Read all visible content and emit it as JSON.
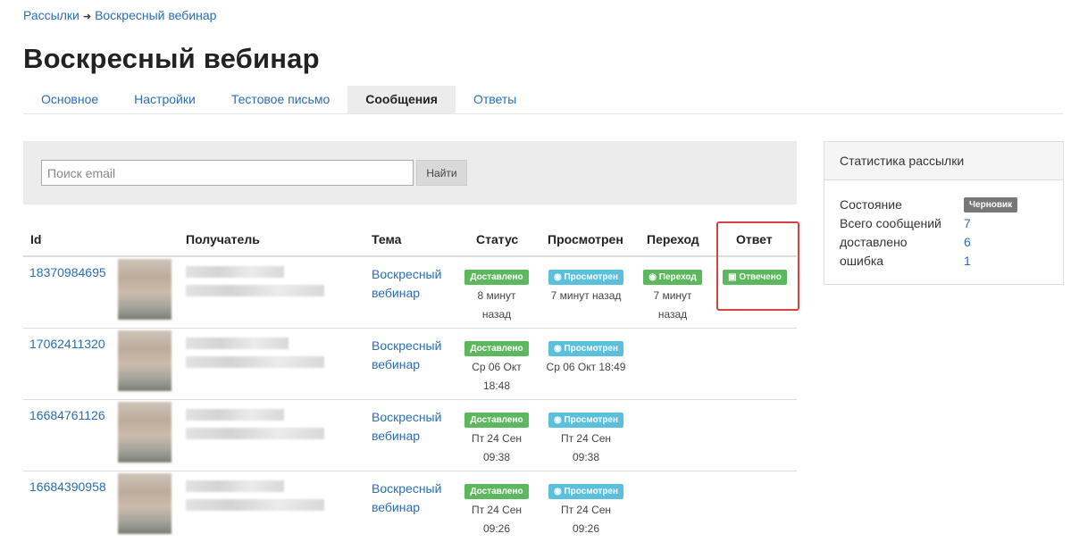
{
  "breadcrumb": {
    "parent": "Рассылки",
    "current": "Воскресный вебинар"
  },
  "page_title": "Воскресный вебинар",
  "tabs": [
    "Основное",
    "Настройки",
    "Тестовое письмо",
    "Сообщения",
    "Ответы"
  ],
  "search": {
    "placeholder": "Поиск email",
    "button": "Найти"
  },
  "table": {
    "headers": {
      "id": "Id",
      "recipient": "Получатель",
      "subject": "Тема",
      "status": "Статус",
      "viewed": "Просмотрен",
      "click": "Переход",
      "reply": "Ответ"
    },
    "rows": [
      {
        "id": "18370984695",
        "subject": "Воскресный вебинар",
        "status": "Доставлено",
        "status_time": "8 минут назад",
        "viewed": "Просмотрен",
        "viewed_time": "7 минут назад",
        "click": "Переход",
        "click_time": "7 минут назад",
        "reply": "Отвечено"
      },
      {
        "id": "17062411320",
        "subject": "Воскресный вебинар",
        "status": "Доставлено",
        "status_time": "Ср 06 Окт 18:48",
        "viewed": "Просмотрен",
        "viewed_time": "Ср 06 Окт 18:49"
      },
      {
        "id": "16684761126",
        "subject": "Воскресный вебинар",
        "status": "Доставлено",
        "status_time": "Пт 24 Сен 09:38",
        "viewed": "Просмотрен",
        "viewed_time": "Пт 24 Сен 09:38"
      },
      {
        "id": "16684390958",
        "subject": "Воскресный вебинар",
        "status": "Доставлено",
        "status_time": "Пт 24 Сен 09:26",
        "viewed": "Просмотрен",
        "viewed_time": "Пт 24 Сен 09:26"
      }
    ]
  },
  "stats": {
    "title": "Статистика рассылки",
    "state_label": "Состояние",
    "state_value": "Черновик",
    "total_label": "Всего сообщений",
    "total_value": "7",
    "delivered_label": "доставлено",
    "delivered_value": "6",
    "error_label": "ошибка",
    "error_value": "1"
  },
  "colors": {
    "link": "#2a6db5",
    "green": "#5cb85c",
    "blue": "#5bc0de",
    "highlight": "#d9413f"
  },
  "icons": {
    "viewed": "eye-icon",
    "click": "eye-icon",
    "reply": "inbox-icon"
  }
}
